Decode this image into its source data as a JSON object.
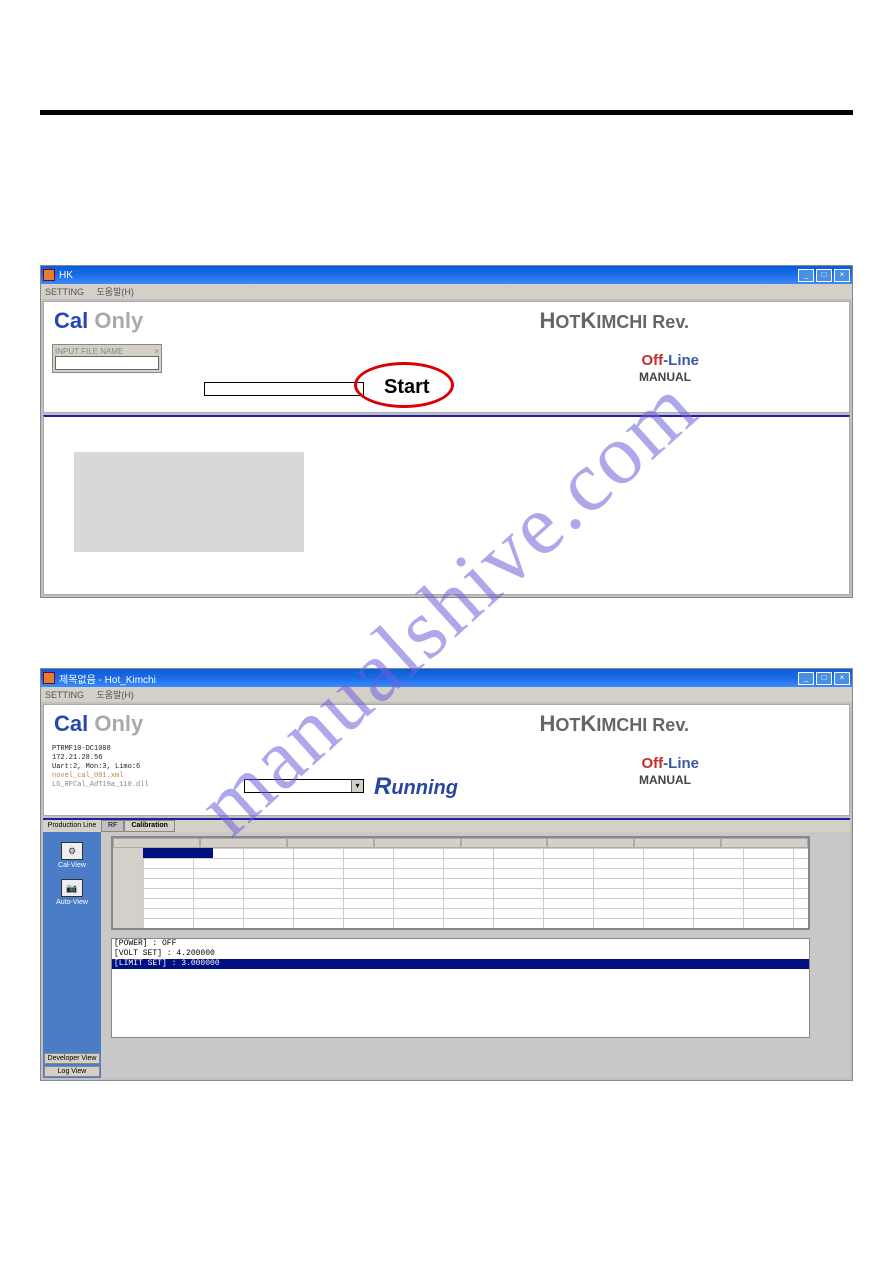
{
  "watermark": "manualshive.com",
  "window1": {
    "title": "HK",
    "menu": {
      "item1": "SETTING",
      "item2": "도움말(H)"
    },
    "cal_label": "Cal",
    "only_label": "Only",
    "brand_h": "H",
    "brand_ot": "OT",
    "brand_k": "K",
    "brand_imchi_rev": "IMCHI Rev.",
    "input_box_title": "INPUT FILE NAME",
    "close_x": "×",
    "off_text": "Off",
    "line_text": "-Line",
    "manual_text": "MANUAL",
    "start_text": "Start",
    "winbtns": {
      "min": "_",
      "max": "□",
      "close": "×"
    }
  },
  "window2": {
    "title": "제목없음 - Hot_Kimchi",
    "menu": {
      "item1": "SETTING",
      "item2": "도움말(H)"
    },
    "cal_label": "Cal",
    "only_label": "Only",
    "brand_h": "H",
    "brand_ot": "OT",
    "brand_k": "K",
    "brand_imchi_rev": "IMCHI Rev.",
    "device_info": {
      "l1": "PTRMF10-DC1008",
      "l2": "172.21.28.56",
      "l3": "Uart:2, Mon:3, Limo:6",
      "l4": "novel_cal_001.xml",
      "l5": "LG_RFCal_AdT19a_110.dll"
    },
    "off_text": "Off",
    "line_text": "-Line",
    "manual_text": "MANUAL",
    "running_r": "R",
    "running_rest": "unning",
    "left_panel": {
      "tab_top": "Production Line",
      "item1": "Cal-View",
      "item2": "Auto-View",
      "bot1": "Developer View",
      "bot2": "Log View"
    },
    "tabs": {
      "rf": "RF",
      "cal": "Calibration"
    },
    "console": {
      "l1": "[POWER] : OFF",
      "l2": "[VOLT SET] : 4.200000",
      "l3": "[LIMIT SET] : 3.000000"
    },
    "winbtns": {
      "min": "_",
      "max": "□",
      "close": "×"
    }
  }
}
